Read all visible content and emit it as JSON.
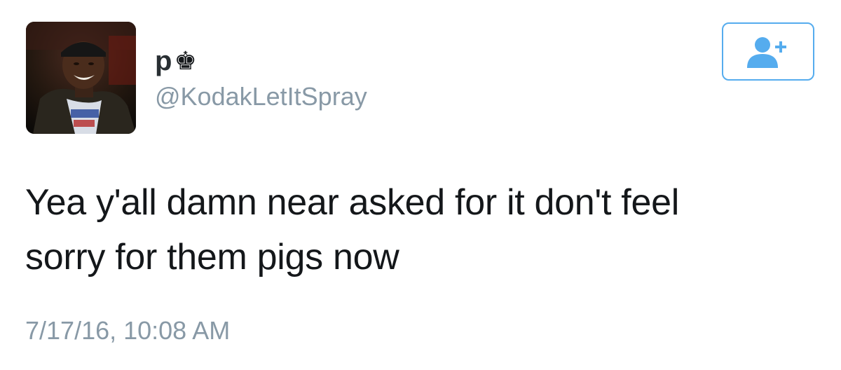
{
  "author": {
    "display_name": "p",
    "name_badge_glyph": "♚",
    "handle": "@KodakLetItSpray"
  },
  "follow_button": {
    "icon": "add-user-icon",
    "color": "#55acee"
  },
  "tweet": {
    "text_lines": [
      "Yea y'all damn near asked for it don't feel",
      "sorry for them pigs now"
    ],
    "timestamp": "7/17/16, 10:08 AM"
  },
  "colors": {
    "text": "#14171a",
    "muted": "#8899a6",
    "accent": "#55acee"
  }
}
